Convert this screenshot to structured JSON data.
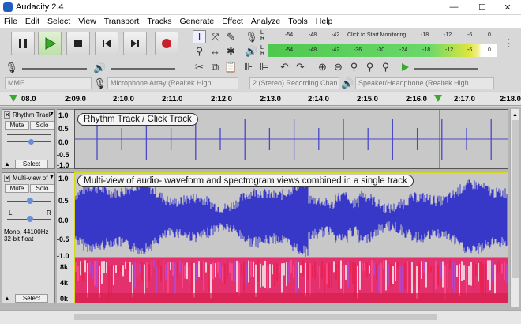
{
  "window": {
    "title": "Audacity 2.4",
    "minimize": "—",
    "maximize": "☐",
    "close": "✕"
  },
  "menu": [
    "File",
    "Edit",
    "Select",
    "View",
    "Transport",
    "Tracks",
    "Generate",
    "Effect",
    "Analyze",
    "Tools",
    "Help"
  ],
  "meters": {
    "record": {
      "channels": [
        "L",
        "R"
      ],
      "ticks": [
        "-54",
        "-48",
        "-42",
        "-18",
        "-12",
        "-6",
        "0"
      ],
      "prompt": "Click to Start Monitoring"
    },
    "playback": {
      "channels": [
        "L",
        "R"
      ],
      "ticks": [
        "-54",
        "-48",
        "-42",
        "-36",
        "-30",
        "-24",
        "-18",
        "-12",
        "-6",
        "0"
      ]
    }
  },
  "devices": {
    "host": "MME",
    "mic": "Microphone Array (Realtek High",
    "channels": "2 (Stereo) Recording Chan",
    "speaker": "Speaker/Headphone (Realtek High"
  },
  "ruler": {
    "ticks": [
      "08.0",
      "2:09.0",
      "2:10.0",
      "2:11.0",
      "2:12.0",
      "2:13.0",
      "2:14.0",
      "2:15.0",
      "2:16.0",
      "2:17.0",
      "2:18.0"
    ]
  },
  "tracks": [
    {
      "name": "Rhythm Track",
      "mute": "Mute",
      "solo": "Solo",
      "select": "Select",
      "scale": [
        "1.0",
        "0.5",
        "0.0",
        "-0.5",
        "-1.0"
      ],
      "annotation": "Rhythm Track / Click Track"
    },
    {
      "name": "Multi-view of",
      "mute": "Mute",
      "solo": "Solo",
      "select": "Select",
      "pan_left": "L",
      "pan_right": "R",
      "info_line1": "Mono, 44100Hz",
      "info_line2": "32-bit float",
      "scale": [
        "1.0",
        "0.5",
        "0.0",
        "-0.5",
        "-1.0"
      ],
      "spectro_scale": [
        "8k",
        "4k",
        "0k"
      ],
      "annotation": "Multi-view of audio- waveform and spectrogram views combined in a single track"
    }
  ],
  "colors": {
    "waveform": "#3838c8",
    "rhythm": "#4a4ac6",
    "meter_green": "#5ed65e",
    "meter_yellow": "#e8e83a"
  }
}
